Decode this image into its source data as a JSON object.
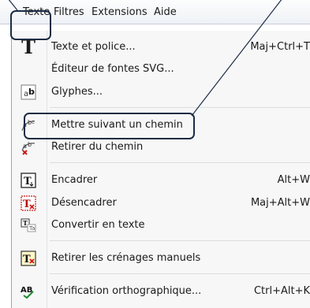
{
  "menubar": {
    "items": [
      {
        "label": "Texte"
      },
      {
        "label": "Filtres"
      },
      {
        "label": "Extensions"
      },
      {
        "label": "Aide"
      }
    ]
  },
  "menu": {
    "items": [
      {
        "label": "Texte et police...",
        "shortcut": "Maj+Ctrl+T",
        "icon": "text-font-icon"
      },
      {
        "label": "Éditeur de fontes SVG...",
        "shortcut": "",
        "icon": ""
      },
      {
        "label": "Glyphes...",
        "shortcut": "",
        "icon": "glyphs-icon"
      },
      {
        "label": "Mettre suivant un chemin",
        "shortcut": "",
        "icon": "text-on-path-icon"
      },
      {
        "label": "Retirer du chemin",
        "shortcut": "",
        "icon": "remove-from-path-icon"
      },
      {
        "label": "Encadrer",
        "shortcut": "Alt+W",
        "icon": "flow-into-frame-icon"
      },
      {
        "label": "Désencadrer",
        "shortcut": "Maj+Alt+W",
        "icon": "unflow-icon"
      },
      {
        "label": "Convertir en texte",
        "shortcut": "",
        "icon": "convert-to-text-icon"
      },
      {
        "label": "Retirer les crénages manuels",
        "shortcut": "",
        "icon": "remove-kerns-icon"
      },
      {
        "label": "Vérification orthographique...",
        "shortcut": "Ctrl+Alt+K",
        "icon": "spellcheck-icon"
      }
    ]
  },
  "colors": {
    "highlight_border": "#1c2d44",
    "accent_red": "#d01818",
    "annotation_line": "#1c2d44"
  }
}
